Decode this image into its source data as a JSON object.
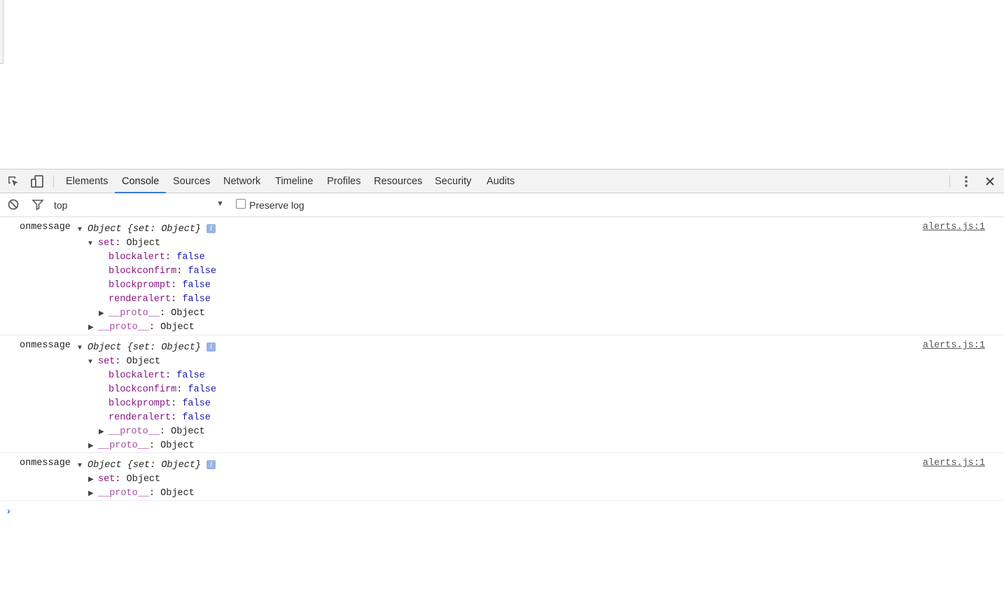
{
  "devtools": {
    "tabs": [
      "Elements",
      "Console",
      "Sources",
      "Network",
      "Timeline",
      "Profiles",
      "Resources",
      "Security",
      "Audits"
    ],
    "active_tab": "Console"
  },
  "toolbar": {
    "context": "top",
    "preserve_log_label": "Preserve log"
  },
  "console": {
    "messages": [
      {
        "label": "onmessage",
        "source": "alerts.js:1",
        "summary_prefix": "Object ",
        "summary": "{set: Object}",
        "info": "i",
        "set_key": "set",
        "set_value": "Object",
        "props": [
          {
            "key": "blockalert",
            "value": "false"
          },
          {
            "key": "blockconfirm",
            "value": "false"
          },
          {
            "key": "blockprompt",
            "value": "false"
          },
          {
            "key": "renderalert",
            "value": "false"
          }
        ],
        "proto_key": "__proto__",
        "proto_value": "Object"
      },
      {
        "label": "onmessage",
        "source": "alerts.js:1",
        "summary_prefix": "Object ",
        "summary": "{set: Object}",
        "info": "i",
        "set_key": "set",
        "set_value": "Object",
        "props": [
          {
            "key": "blockalert",
            "value": "false"
          },
          {
            "key": "blockconfirm",
            "value": "false"
          },
          {
            "key": "blockprompt",
            "value": "false"
          },
          {
            "key": "renderalert",
            "value": "false"
          }
        ],
        "proto_key": "__proto__",
        "proto_value": "Object"
      },
      {
        "label": "onmessage",
        "source": "alerts.js:1",
        "summary_prefix": "Object ",
        "summary": "{set: Object}",
        "info": "i",
        "set_key": "set",
        "set_value": "Object",
        "proto_key": "__proto__",
        "proto_value": "Object"
      }
    ],
    "prompt": "›"
  }
}
